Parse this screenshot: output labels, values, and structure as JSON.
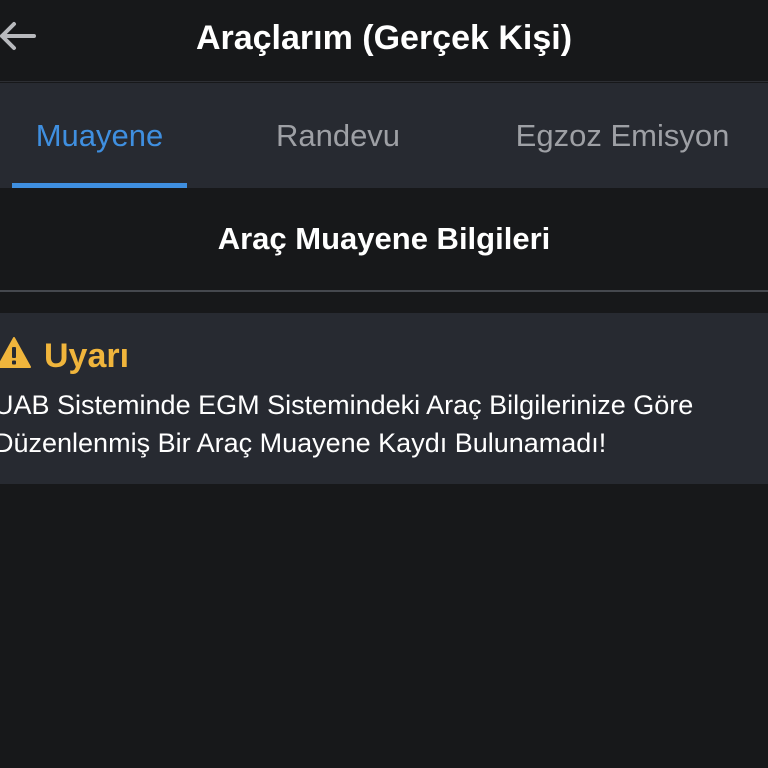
{
  "header": {
    "title": "Araçlarım (Gerçek Kişi)",
    "back_icon": "arrow-left-icon"
  },
  "tabs": [
    {
      "label": "Muayene",
      "active": true
    },
    {
      "label": "Randevu",
      "active": false
    },
    {
      "label": "Egzoz Emisyon",
      "active": false
    }
  ],
  "section": {
    "title": "Araç Muayene Bilgileri"
  },
  "warning": {
    "icon": "warning-triangle-icon",
    "title": "Uyarı",
    "message_line1": "UAB Sisteminde EGM Sistemindeki Araç Bilgilerinize Göre",
    "message_line2": "Düzenlenmiş Bir Araç Muayene Kaydı Bulunamadı!"
  },
  "colors": {
    "background": "#17181a",
    "surface": "#272a31",
    "accent": "#3f8fe0",
    "warning": "#f0b53c",
    "tab_inactive": "#9ea0a5"
  }
}
